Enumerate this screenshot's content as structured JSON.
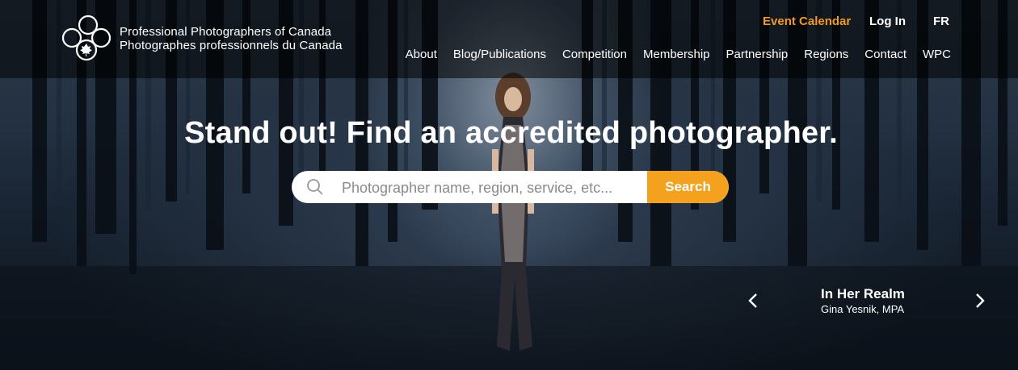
{
  "org": {
    "name_en": "Professional Photographers of Canada",
    "name_fr": "Photographes professionnels du Canada",
    "logo_icon": "ppoc-circles-maple-leaf-icon"
  },
  "utility_nav": {
    "event_calendar": "Event Calendar",
    "login": "Log In",
    "language": "FR",
    "event_color": "#f39a1f"
  },
  "main_nav": [
    "About",
    "Blog/Publications",
    "Competition",
    "Membership",
    "Partnership",
    "Regions",
    "Contact",
    "WPC"
  ],
  "hero": {
    "headline": "Stand out! Find an accredited photographer."
  },
  "search": {
    "placeholder": "Photographer name, region, service, etc...",
    "value": "",
    "button_label": "Search",
    "button_color": "#f4a21d",
    "icon": "search-icon"
  },
  "slide_caption": {
    "title": "In Her Realm",
    "author": "Gina Yesnik, MPA",
    "prev_icon": "chevron-left-icon",
    "next_icon": "chevron-right-icon"
  }
}
